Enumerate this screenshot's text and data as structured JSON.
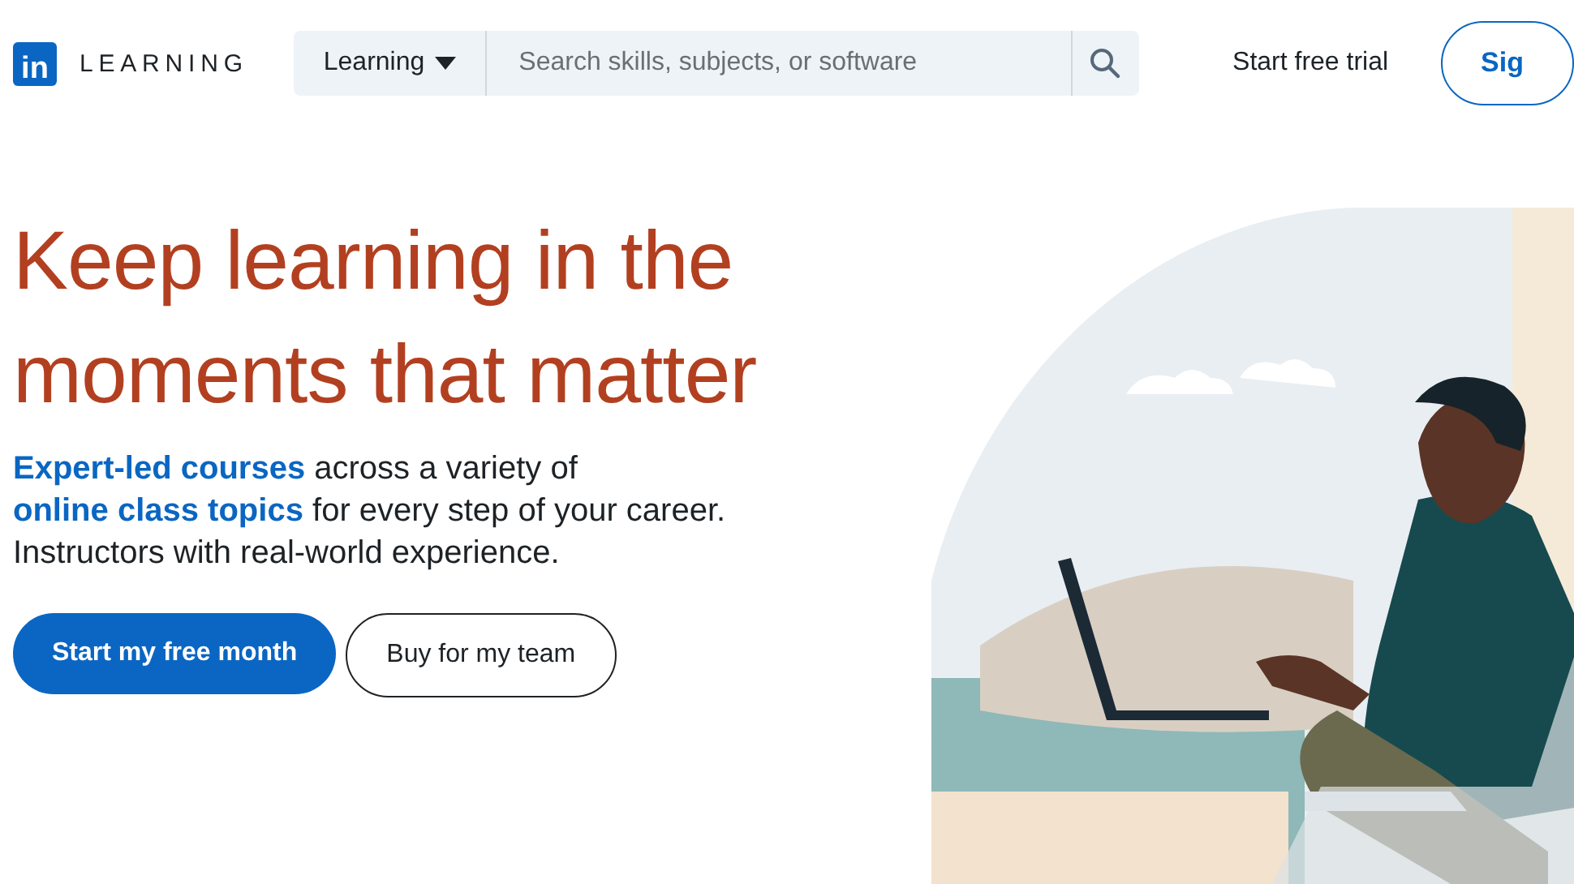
{
  "header": {
    "logo_mark": "in",
    "logo_text": "LEARNING",
    "search": {
      "scope": "Learning",
      "placeholder": "Search skills, subjects, or software"
    },
    "nav": [
      {
        "label": "Start free trial",
        "kind": "link"
      },
      {
        "label": "Sig",
        "kind": "outline"
      }
    ]
  },
  "hero": {
    "title": "Keep learning in the moments that matter",
    "description": [
      {
        "text": "Expert-led courses",
        "kind": "link"
      },
      {
        "text": " across a variety of ",
        "kind": "plain"
      },
      {
        "text": "online class topics",
        "kind": "link"
      },
      {
        "text": " for every step of your career. Instructors with real-world experience.",
        "kind": "plain"
      }
    ],
    "buttons": [
      {
        "label": "Start my free month",
        "kind": "primary"
      },
      {
        "label": "Buy for my team",
        "kind": "secondary"
      }
    ]
  }
}
